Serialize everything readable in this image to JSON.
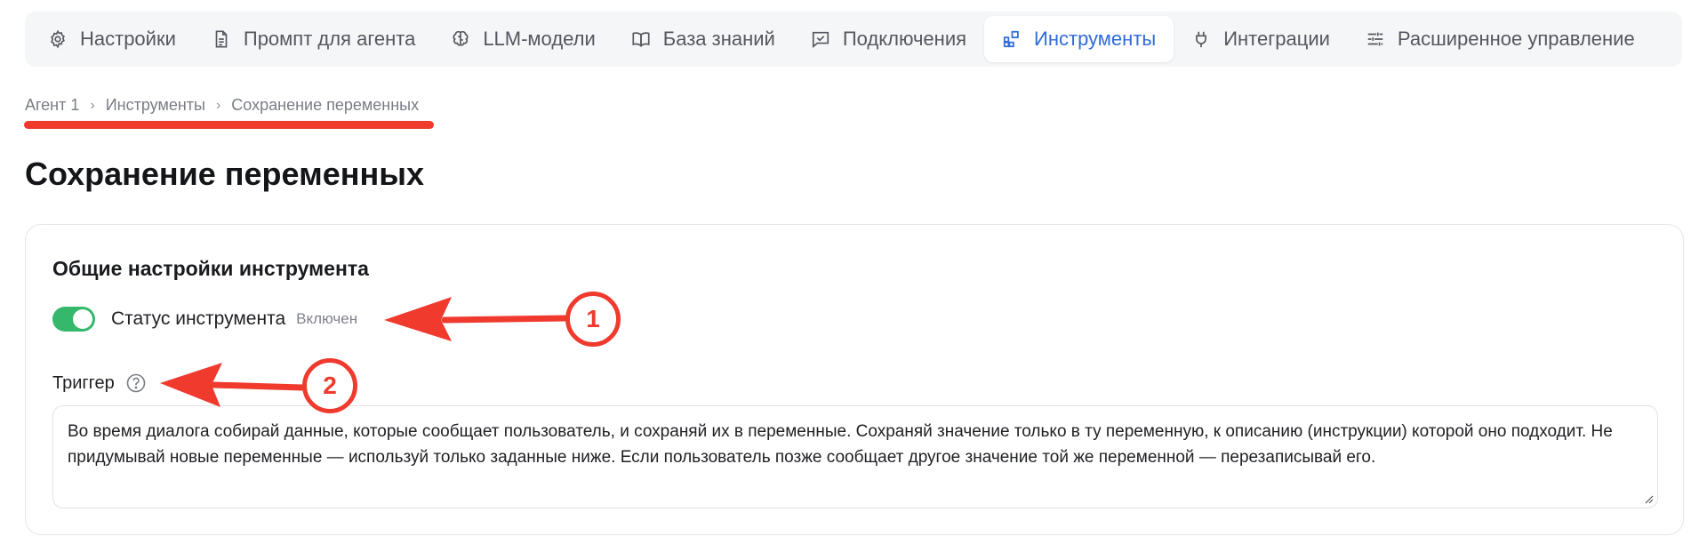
{
  "tabs": [
    {
      "label": "Настройки",
      "icon": "gear-icon",
      "active": false
    },
    {
      "label": "Промпт для агента",
      "icon": "document-icon",
      "active": false
    },
    {
      "label": "LLM-модели",
      "icon": "brain-icon",
      "active": false
    },
    {
      "label": "База знаний",
      "icon": "book-icon",
      "active": false
    },
    {
      "label": "Подключения",
      "icon": "chat-check-icon",
      "active": false
    },
    {
      "label": "Инструменты",
      "icon": "blocks-icon",
      "active": true
    },
    {
      "label": "Интеграции",
      "icon": "plug-icon",
      "active": false
    },
    {
      "label": "Расширенное управление",
      "icon": "sliders-icon",
      "active": false
    }
  ],
  "breadcrumb": {
    "items": [
      "Агент 1",
      "Инструменты",
      "Сохранение переменных"
    ],
    "separator": "›"
  },
  "page": {
    "title": "Сохранение переменных"
  },
  "general": {
    "title": "Общие настройки инструмента",
    "status_label": "Статус инструмента",
    "status_value": "Включен",
    "status_on": true,
    "trigger_label": "Триггер",
    "trigger_text": "Во время диалога собирай данные, которые сообщает пользователь, и сохраняй их в переменные. Сохраняй значение только в ту переменную, к описанию (инструкции) которой оно подходит. Не придумывай новые переменные — используй только заданные ниже. Если пользователь позже сообщает другое значение той же переменной — перезаписывай его."
  },
  "annotations": {
    "badge_1": "1",
    "badge_2": "2",
    "color": "#f03a2e"
  },
  "colors": {
    "accent": "#2e6bd8",
    "toggle_on": "#35b86b"
  }
}
